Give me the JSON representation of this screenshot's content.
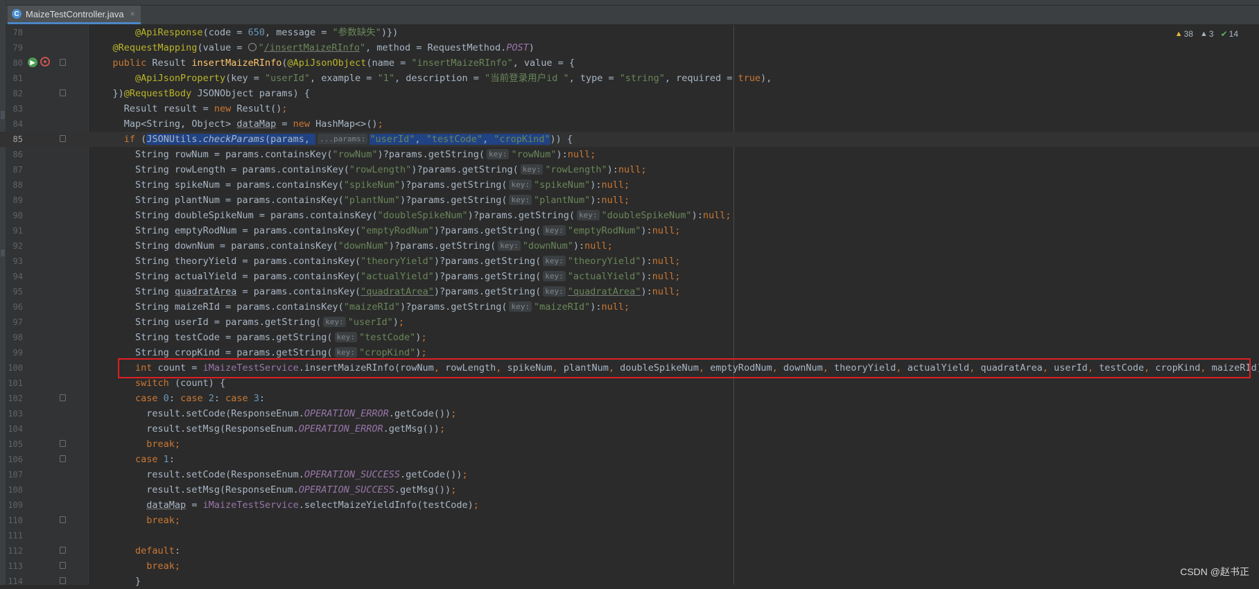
{
  "tab": {
    "icon": "class-c-icon",
    "icon_glyph": "C",
    "filename": "MaizeTestController.java",
    "close": "×"
  },
  "inspection": {
    "warnings": "38",
    "weak_warnings": "3",
    "typos": "14"
  },
  "watermark": "CSDN @赵书正",
  "current_line": "85",
  "lines": [
    {
      "n": "78",
      "fold": false,
      "t": [
        [
          "@ApiResponse",
          "an"
        ],
        [
          "(code = ",
          ""
        ],
        [
          "650",
          "n"
        ],
        [
          ", message = ",
          ""
        ],
        [
          "\"参数缺失\"",
          "s"
        ],
        [
          ")})",
          ""
        ]
      ]
    },
    {
      "n": "79",
      "fold": false,
      "t": [
        [
          "@RequestMapping",
          "an"
        ],
        [
          "(value = ",
          ""
        ],
        [
          "",
          "ic"
        ],
        [
          "\"",
          "s"
        ],
        [
          "/insertMaizeRInfo",
          "su"
        ],
        [
          "\"",
          "s"
        ],
        [
          ", method = RequestMethod.",
          ""
        ],
        [
          "POST",
          "fld"
        ],
        [
          ")",
          ""
        ]
      ]
    },
    {
      "n": "80",
      "fold": true,
      "t": [
        [
          "public ",
          "k"
        ],
        [
          "Result ",
          ""
        ],
        [
          "insertMaizeRInfo",
          "fn"
        ],
        [
          "(",
          ""
        ],
        [
          "@ApiJsonObject",
          "an"
        ],
        [
          "(name = ",
          ""
        ],
        [
          "\"insertMaizeRInfo\"",
          "s"
        ],
        [
          ", value = {",
          ""
        ]
      ]
    },
    {
      "n": "81",
      "fold": false,
      "t": [
        [
          "@ApiJsonProperty",
          "an"
        ],
        [
          "(key = ",
          ""
        ],
        [
          "\"userId\"",
          "s"
        ],
        [
          ", example = ",
          ""
        ],
        [
          "\"1\"",
          "s"
        ],
        [
          ", description = ",
          ""
        ],
        [
          "\"当前登录用户id \"",
          "s"
        ],
        [
          ", type = ",
          ""
        ],
        [
          "\"string\"",
          "s"
        ],
        [
          ", required = ",
          ""
        ],
        [
          "true",
          "k"
        ],
        [
          "),",
          ""
        ]
      ]
    },
    {
      "n": "82",
      "fold": true,
      "t": [
        [
          "})",
          ""
        ],
        [
          "@RequestBody",
          "an"
        ],
        [
          " JSONObject params) {",
          ""
        ]
      ]
    },
    {
      "n": "83",
      "fold": false,
      "t": [
        [
          "Result result = ",
          ""
        ],
        [
          "new ",
          "k"
        ],
        [
          "Result()",
          ""
        ],
        [
          ";",
          "k"
        ]
      ]
    },
    {
      "n": "84",
      "fold": false,
      "t": [
        [
          "Map<String, Object> ",
          ""
        ],
        [
          "dataMap",
          "u"
        ],
        [
          " = ",
          ""
        ],
        [
          "new ",
          "k"
        ],
        [
          "HashMap<>()",
          ""
        ],
        [
          ";",
          "k"
        ]
      ]
    },
    {
      "n": "85",
      "fold": true,
      "t": [
        [
          "if ",
          "k"
        ],
        [
          "(",
          ""
        ],
        [
          "JSONUtils.",
          "sel"
        ],
        [
          "checkParams",
          "selst"
        ],
        [
          "(params, ",
          "sel"
        ],
        [
          "...params:",
          "hintsel"
        ],
        [
          "\"userId\"",
          "ssel"
        ],
        [
          ", ",
          "sel"
        ],
        [
          "\"testCode\"",
          "ssel"
        ],
        [
          ", ",
          "sel"
        ],
        [
          "\"cropKind\"",
          "ssel"
        ],
        [
          ")",
          ""
        ],
        [
          ") {",
          ""
        ]
      ]
    },
    {
      "n": "86",
      "fold": false,
      "t": [
        [
          "String rowNum = params.containsKey(",
          ""
        ],
        [
          "\"rowNum\"",
          "s"
        ],
        [
          ")?params.getString(",
          ""
        ],
        [
          "key:",
          "hint"
        ],
        [
          "\"rowNum\"",
          "s"
        ],
        [
          "):",
          ""
        ],
        [
          "null",
          "k"
        ],
        [
          ";",
          "k"
        ]
      ]
    },
    {
      "n": "87",
      "fold": false,
      "t": [
        [
          "String rowLength = params.containsKey(",
          ""
        ],
        [
          "\"rowLength\"",
          "s"
        ],
        [
          ")?params.getString(",
          ""
        ],
        [
          "key:",
          "hint"
        ],
        [
          "\"rowLength\"",
          "s"
        ],
        [
          "):",
          ""
        ],
        [
          "null",
          "k"
        ],
        [
          ";",
          "k"
        ]
      ]
    },
    {
      "n": "88",
      "fold": false,
      "t": [
        [
          "String spikeNum = params.containsKey(",
          ""
        ],
        [
          "\"spikeNum\"",
          "s"
        ],
        [
          ")?params.getString(",
          ""
        ],
        [
          "key:",
          "hint"
        ],
        [
          "\"spikeNum\"",
          "s"
        ],
        [
          "):",
          ""
        ],
        [
          "null",
          "k"
        ],
        [
          ";",
          "k"
        ]
      ]
    },
    {
      "n": "89",
      "fold": false,
      "t": [
        [
          "String plantNum = params.containsKey(",
          ""
        ],
        [
          "\"plantNum\"",
          "s"
        ],
        [
          ")?params.getString(",
          ""
        ],
        [
          "key:",
          "hint"
        ],
        [
          "\"plantNum\"",
          "s"
        ],
        [
          "):",
          ""
        ],
        [
          "null",
          "k"
        ],
        [
          ";",
          "k"
        ]
      ]
    },
    {
      "n": "90",
      "fold": false,
      "t": [
        [
          "String doubleSpikeNum = params.containsKey(",
          ""
        ],
        [
          "\"doubleSpikeNum\"",
          "s"
        ],
        [
          ")?params.getString(",
          ""
        ],
        [
          "key:",
          "hint"
        ],
        [
          "\"doubleSpikeNum\"",
          "s"
        ],
        [
          "):",
          ""
        ],
        [
          "null",
          "k"
        ],
        [
          ";",
          "k"
        ]
      ]
    },
    {
      "n": "91",
      "fold": false,
      "t": [
        [
          "String emptyRodNum = params.containsKey(",
          ""
        ],
        [
          "\"emptyRodNum\"",
          "s"
        ],
        [
          ")?params.getString(",
          ""
        ],
        [
          "key:",
          "hint"
        ],
        [
          "\"emptyRodNum\"",
          "s"
        ],
        [
          "):",
          ""
        ],
        [
          "null",
          "k"
        ],
        [
          ";",
          "k"
        ]
      ]
    },
    {
      "n": "92",
      "fold": false,
      "t": [
        [
          "String downNum = params.containsKey(",
          ""
        ],
        [
          "\"downNum\"",
          "s"
        ],
        [
          ")?params.getString(",
          ""
        ],
        [
          "key:",
          "hint"
        ],
        [
          "\"downNum\"",
          "s"
        ],
        [
          "):",
          ""
        ],
        [
          "null",
          "k"
        ],
        [
          ";",
          "k"
        ]
      ]
    },
    {
      "n": "93",
      "fold": false,
      "t": [
        [
          "String theoryYield = params.containsKey(",
          ""
        ],
        [
          "\"theoryYield\"",
          "s"
        ],
        [
          ")?params.getString(",
          ""
        ],
        [
          "key:",
          "hint"
        ],
        [
          "\"theoryYield\"",
          "s"
        ],
        [
          "):",
          ""
        ],
        [
          "null",
          "k"
        ],
        [
          ";",
          "k"
        ]
      ]
    },
    {
      "n": "94",
      "fold": false,
      "t": [
        [
          "String actualYield = params.containsKey(",
          ""
        ],
        [
          "\"actualYield\"",
          "s"
        ],
        [
          ")?params.getString(",
          ""
        ],
        [
          "key:",
          "hint"
        ],
        [
          "\"actualYield\"",
          "s"
        ],
        [
          "):",
          ""
        ],
        [
          "null",
          "k"
        ],
        [
          ";",
          "k"
        ]
      ]
    },
    {
      "n": "95",
      "fold": false,
      "t": [
        [
          "String ",
          ""
        ],
        [
          "quadratArea",
          "u"
        ],
        [
          " = params.containsKey(",
          ""
        ],
        [
          "\"quadratArea\"",
          "su"
        ],
        [
          ")?params.getString(",
          ""
        ],
        [
          "key:",
          "hint"
        ],
        [
          "\"quadratArea\"",
          "su"
        ],
        [
          "):",
          ""
        ],
        [
          "null",
          "k"
        ],
        [
          ";",
          "k"
        ]
      ]
    },
    {
      "n": "96",
      "fold": false,
      "t": [
        [
          "String maizeRId = params.containsKey(",
          ""
        ],
        [
          "\"maizeRId\"",
          "s"
        ],
        [
          ")?params.getString(",
          ""
        ],
        [
          "key:",
          "hint"
        ],
        [
          "\"maizeRId\"",
          "s"
        ],
        [
          "):",
          ""
        ],
        [
          "null",
          "k"
        ],
        [
          ";",
          "k"
        ]
      ]
    },
    {
      "n": "97",
      "fold": false,
      "t": [
        [
          "String userId = params.getString(",
          ""
        ],
        [
          "key:",
          "hint"
        ],
        [
          "\"userId\"",
          "s"
        ],
        [
          ")",
          ""
        ],
        [
          ";",
          "k"
        ]
      ]
    },
    {
      "n": "98",
      "fold": false,
      "t": [
        [
          "String testCode = params.getString(",
          ""
        ],
        [
          "key:",
          "hint"
        ],
        [
          "\"testCode\"",
          "s"
        ],
        [
          ")",
          ""
        ],
        [
          ";",
          "k"
        ]
      ]
    },
    {
      "n": "99",
      "fold": false,
      "t": [
        [
          "String cropKind = params.getString(",
          ""
        ],
        [
          "key:",
          "hint"
        ],
        [
          "\"cropKind\"",
          "s"
        ],
        [
          ")",
          ""
        ],
        [
          ";",
          "k"
        ]
      ]
    },
    {
      "n": "100",
      "fold": false,
      "t": [
        [
          "int ",
          "k"
        ],
        [
          "count = ",
          ""
        ],
        [
          "iMaizeTestService",
          "fldn"
        ],
        [
          ".insertMaizeRInfo(rowNum",
          ""
        ],
        [
          ", ",
          "k"
        ],
        [
          "rowLength",
          ""
        ],
        [
          ", ",
          "k"
        ],
        [
          "spikeNum",
          ""
        ],
        [
          ", ",
          "k"
        ],
        [
          "plantNum",
          ""
        ],
        [
          ", ",
          "k"
        ],
        [
          "doubleSpikeNum",
          ""
        ],
        [
          ", ",
          "k"
        ],
        [
          "emptyRodNum",
          ""
        ],
        [
          ", ",
          "k"
        ],
        [
          "downNum",
          ""
        ],
        [
          ", ",
          "k"
        ],
        [
          "theoryYield",
          ""
        ],
        [
          ", ",
          "k"
        ],
        [
          "actualYield",
          ""
        ],
        [
          ", ",
          "k"
        ],
        [
          "quadratArea",
          ""
        ],
        [
          ", ",
          "k"
        ],
        [
          "userId",
          ""
        ],
        [
          ", ",
          "k"
        ],
        [
          "testCode",
          ""
        ],
        [
          ", ",
          "k"
        ],
        [
          "cropKind",
          ""
        ],
        [
          ", ",
          "k"
        ],
        [
          "maizeRId)",
          ""
        ],
        [
          ";",
          "k"
        ]
      ]
    },
    {
      "n": "101",
      "fold": false,
      "t": [
        [
          "switch ",
          "k"
        ],
        [
          "(count) {",
          ""
        ]
      ]
    },
    {
      "n": "102",
      "fold": true,
      "t": [
        [
          "case ",
          "k"
        ],
        [
          "0",
          "n"
        ],
        [
          ": ",
          ""
        ],
        [
          "case ",
          "k"
        ],
        [
          "2",
          "n"
        ],
        [
          ": ",
          ""
        ],
        [
          "case ",
          "k"
        ],
        [
          "3",
          "n"
        ],
        [
          ":",
          ""
        ]
      ]
    },
    {
      "n": "103",
      "fold": false,
      "t": [
        [
          "result.setCode(ResponseEnum.",
          ""
        ],
        [
          "OPERATION_ERROR",
          "fld"
        ],
        [
          ".getCode())",
          ""
        ],
        [
          ";",
          "k"
        ]
      ]
    },
    {
      "n": "104",
      "fold": false,
      "t": [
        [
          "result.setMsg(ResponseEnum.",
          ""
        ],
        [
          "OPERATION_ERROR",
          "fld"
        ],
        [
          ".getMsg())",
          ""
        ],
        [
          ";",
          "k"
        ]
      ]
    },
    {
      "n": "105",
      "fold": true,
      "t": [
        [
          "break",
          "k"
        ],
        [
          ";",
          "k"
        ]
      ]
    },
    {
      "n": "106",
      "fold": true,
      "t": [
        [
          "case ",
          "k"
        ],
        [
          "1",
          "n"
        ],
        [
          ":",
          ""
        ]
      ]
    },
    {
      "n": "107",
      "fold": false,
      "t": [
        [
          "result.setCode(ResponseEnum.",
          ""
        ],
        [
          "OPERATION_SUCCESS",
          "fld"
        ],
        [
          ".getCode())",
          ""
        ],
        [
          ";",
          "k"
        ]
      ]
    },
    {
      "n": "108",
      "fold": false,
      "t": [
        [
          "result.setMsg(ResponseEnum.",
          ""
        ],
        [
          "OPERATION_SUCCESS",
          "fld"
        ],
        [
          ".getMsg())",
          ""
        ],
        [
          ";",
          "k"
        ]
      ]
    },
    {
      "n": "109",
      "fold": false,
      "t": [
        [
          "dataMap",
          "u"
        ],
        [
          " = ",
          ""
        ],
        [
          "iMaizeTestService",
          "fldn"
        ],
        [
          ".selectMaizeYieldInfo(testCode)",
          ""
        ],
        [
          ";",
          "k"
        ]
      ]
    },
    {
      "n": "110",
      "fold": true,
      "t": [
        [
          "break",
          "k"
        ],
        [
          ";",
          "k"
        ]
      ]
    },
    {
      "n": "111",
      "fold": false,
      "t": []
    },
    {
      "n": "112",
      "fold": true,
      "t": [
        [
          "default",
          "k"
        ],
        [
          ":",
          ""
        ]
      ]
    },
    {
      "n": "113",
      "fold": true,
      "t": [
        [
          "break",
          "k"
        ],
        [
          ";",
          "k"
        ]
      ]
    },
    {
      "n": "114",
      "fold": true,
      "t": [
        [
          "}",
          ""
        ]
      ]
    }
  ]
}
